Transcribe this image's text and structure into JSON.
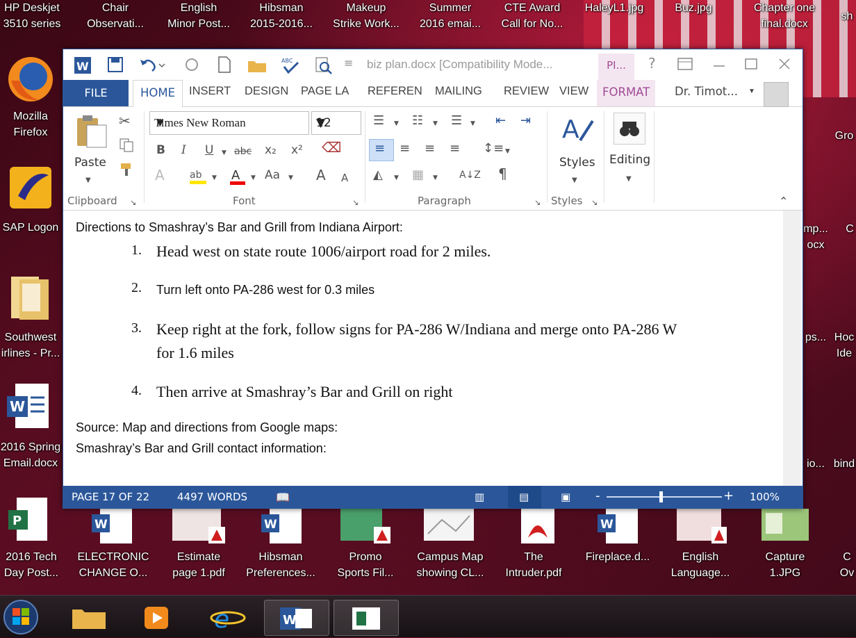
{
  "desktop": {
    "top_icons": [
      {
        "line1": "HP Deskjet",
        "line2": "3510 series"
      },
      {
        "line1": "Chair",
        "line2": "Observati..."
      },
      {
        "line1": "English",
        "line2": "Minor Post..."
      },
      {
        "line1": "Hibsman",
        "line2": "2015-2016..."
      },
      {
        "line1": "Makeup",
        "line2": "Strike Work..."
      },
      {
        "line1": "Summer",
        "line2": "2016 emai..."
      },
      {
        "line1": "CTE Award",
        "line2": "Call for No..."
      },
      {
        "line1": "HaleyL1.jpg",
        "line2": ""
      },
      {
        "line1": "Buz.jpg",
        "line2": ""
      },
      {
        "line1": "Chapter one",
        "line2": "final.docx"
      },
      {
        "line1": "sh",
        "line2": ""
      }
    ],
    "left_icons": [
      {
        "line1": "Mozilla",
        "line2": "Firefox"
      },
      {
        "line1": "SAP Logon",
        "line2": ""
      },
      {
        "line1": "Southwest",
        "line2": "irlines - Pr..."
      },
      {
        "line1": "2016 Spring",
        "line2": "Email.docx"
      }
    ],
    "right_icons": [
      {
        "line1": "Gro",
        "line2": ""
      },
      {
        "line1": "mp...",
        "line2": "ocx"
      },
      {
        "line1": "C",
        "line2": ""
      },
      {
        "line1": "ps...",
        "line2": ""
      },
      {
        "line1": "Hoc",
        "line2": "Ide"
      },
      {
        "line1": "io...",
        "line2": ""
      },
      {
        "line1": "bind",
        "line2": ""
      }
    ],
    "bottom_icons": [
      {
        "line1": "2016 Tech",
        "line2": "Day Post..."
      },
      {
        "line1": "ELECTRONIC",
        "line2": "CHANGE O..."
      },
      {
        "line1": "Estimate",
        "line2": "page 1.pdf"
      },
      {
        "line1": "Hibsman",
        "line2": "Preferences..."
      },
      {
        "line1": "Promo",
        "line2": "Sports Fil..."
      },
      {
        "line1": "Campus Map",
        "line2": "showing CL..."
      },
      {
        "line1": "The",
        "line2": "Intruder.pdf"
      },
      {
        "line1": "Fireplace.d...",
        "line2": ""
      },
      {
        "line1": "English",
        "line2": "Language..."
      },
      {
        "line1": "Capture",
        "line2": "1.JPG"
      },
      {
        "line1": "C",
        "line2": "Ov"
      }
    ]
  },
  "window": {
    "title": "biz plan.docx [Compatibility Mode...",
    "context_tab": "PI...",
    "help": "?",
    "tabs": {
      "file": "FILE",
      "home": "HOME",
      "insert": "INSERT",
      "design": "DESIGN",
      "page_layout": "PAGE LA",
      "references": "REFEREN",
      "mailings": "MAILING",
      "review": "REVIEW",
      "view": "VIEW",
      "format": "FORMAT"
    },
    "user": "Dr. Timot...",
    "ribbon": {
      "paste": "Paste",
      "font_name": "Times New Roman",
      "font_size": "12",
      "styles": "Styles",
      "editing": "Editing",
      "groups": {
        "clipboard": "Clipboard",
        "font": "Font",
        "paragraph": "Paragraph",
        "styles": "Styles"
      },
      "buttons": {
        "bold": "B",
        "italic": "I",
        "underline": "U",
        "strike": "abc",
        "sub": "x₂",
        "sup": "x²",
        "grow": "A",
        "shrink": "A",
        "case": "Aa",
        "pilcrow": "¶",
        "sort": "A↓Z"
      }
    }
  },
  "document": {
    "heading": "Directions to Smashray’s Bar and Grill from Indiana Airport:",
    "steps": [
      {
        "num": "1.",
        "text": "Head west on state route 1006/airport road for 2 miles."
      },
      {
        "num": "2.",
        "text": "Turn left onto PA-286 west for 0.3 miles"
      },
      {
        "num": "3.",
        "text": "Keep right at the fork, follow signs for PA-286 W/Indiana and merge onto PA-286 W",
        "text2": "for 1.6 miles"
      },
      {
        "num": "4.",
        "text": "Then arrive at Smashray’s Bar and Grill on right"
      }
    ],
    "source": "Source: Map and directions from Google maps:",
    "contact": "Smashray’s Bar and Grill contact information:"
  },
  "status": {
    "page": "PAGE 17 OF 22",
    "words": "4497 WORDS",
    "zoom": "100%",
    "zoom_minus": "-",
    "zoom_plus": "+"
  },
  "colors": {
    "word_blue": "#2b579a",
    "format_tab": "#a24a95"
  }
}
